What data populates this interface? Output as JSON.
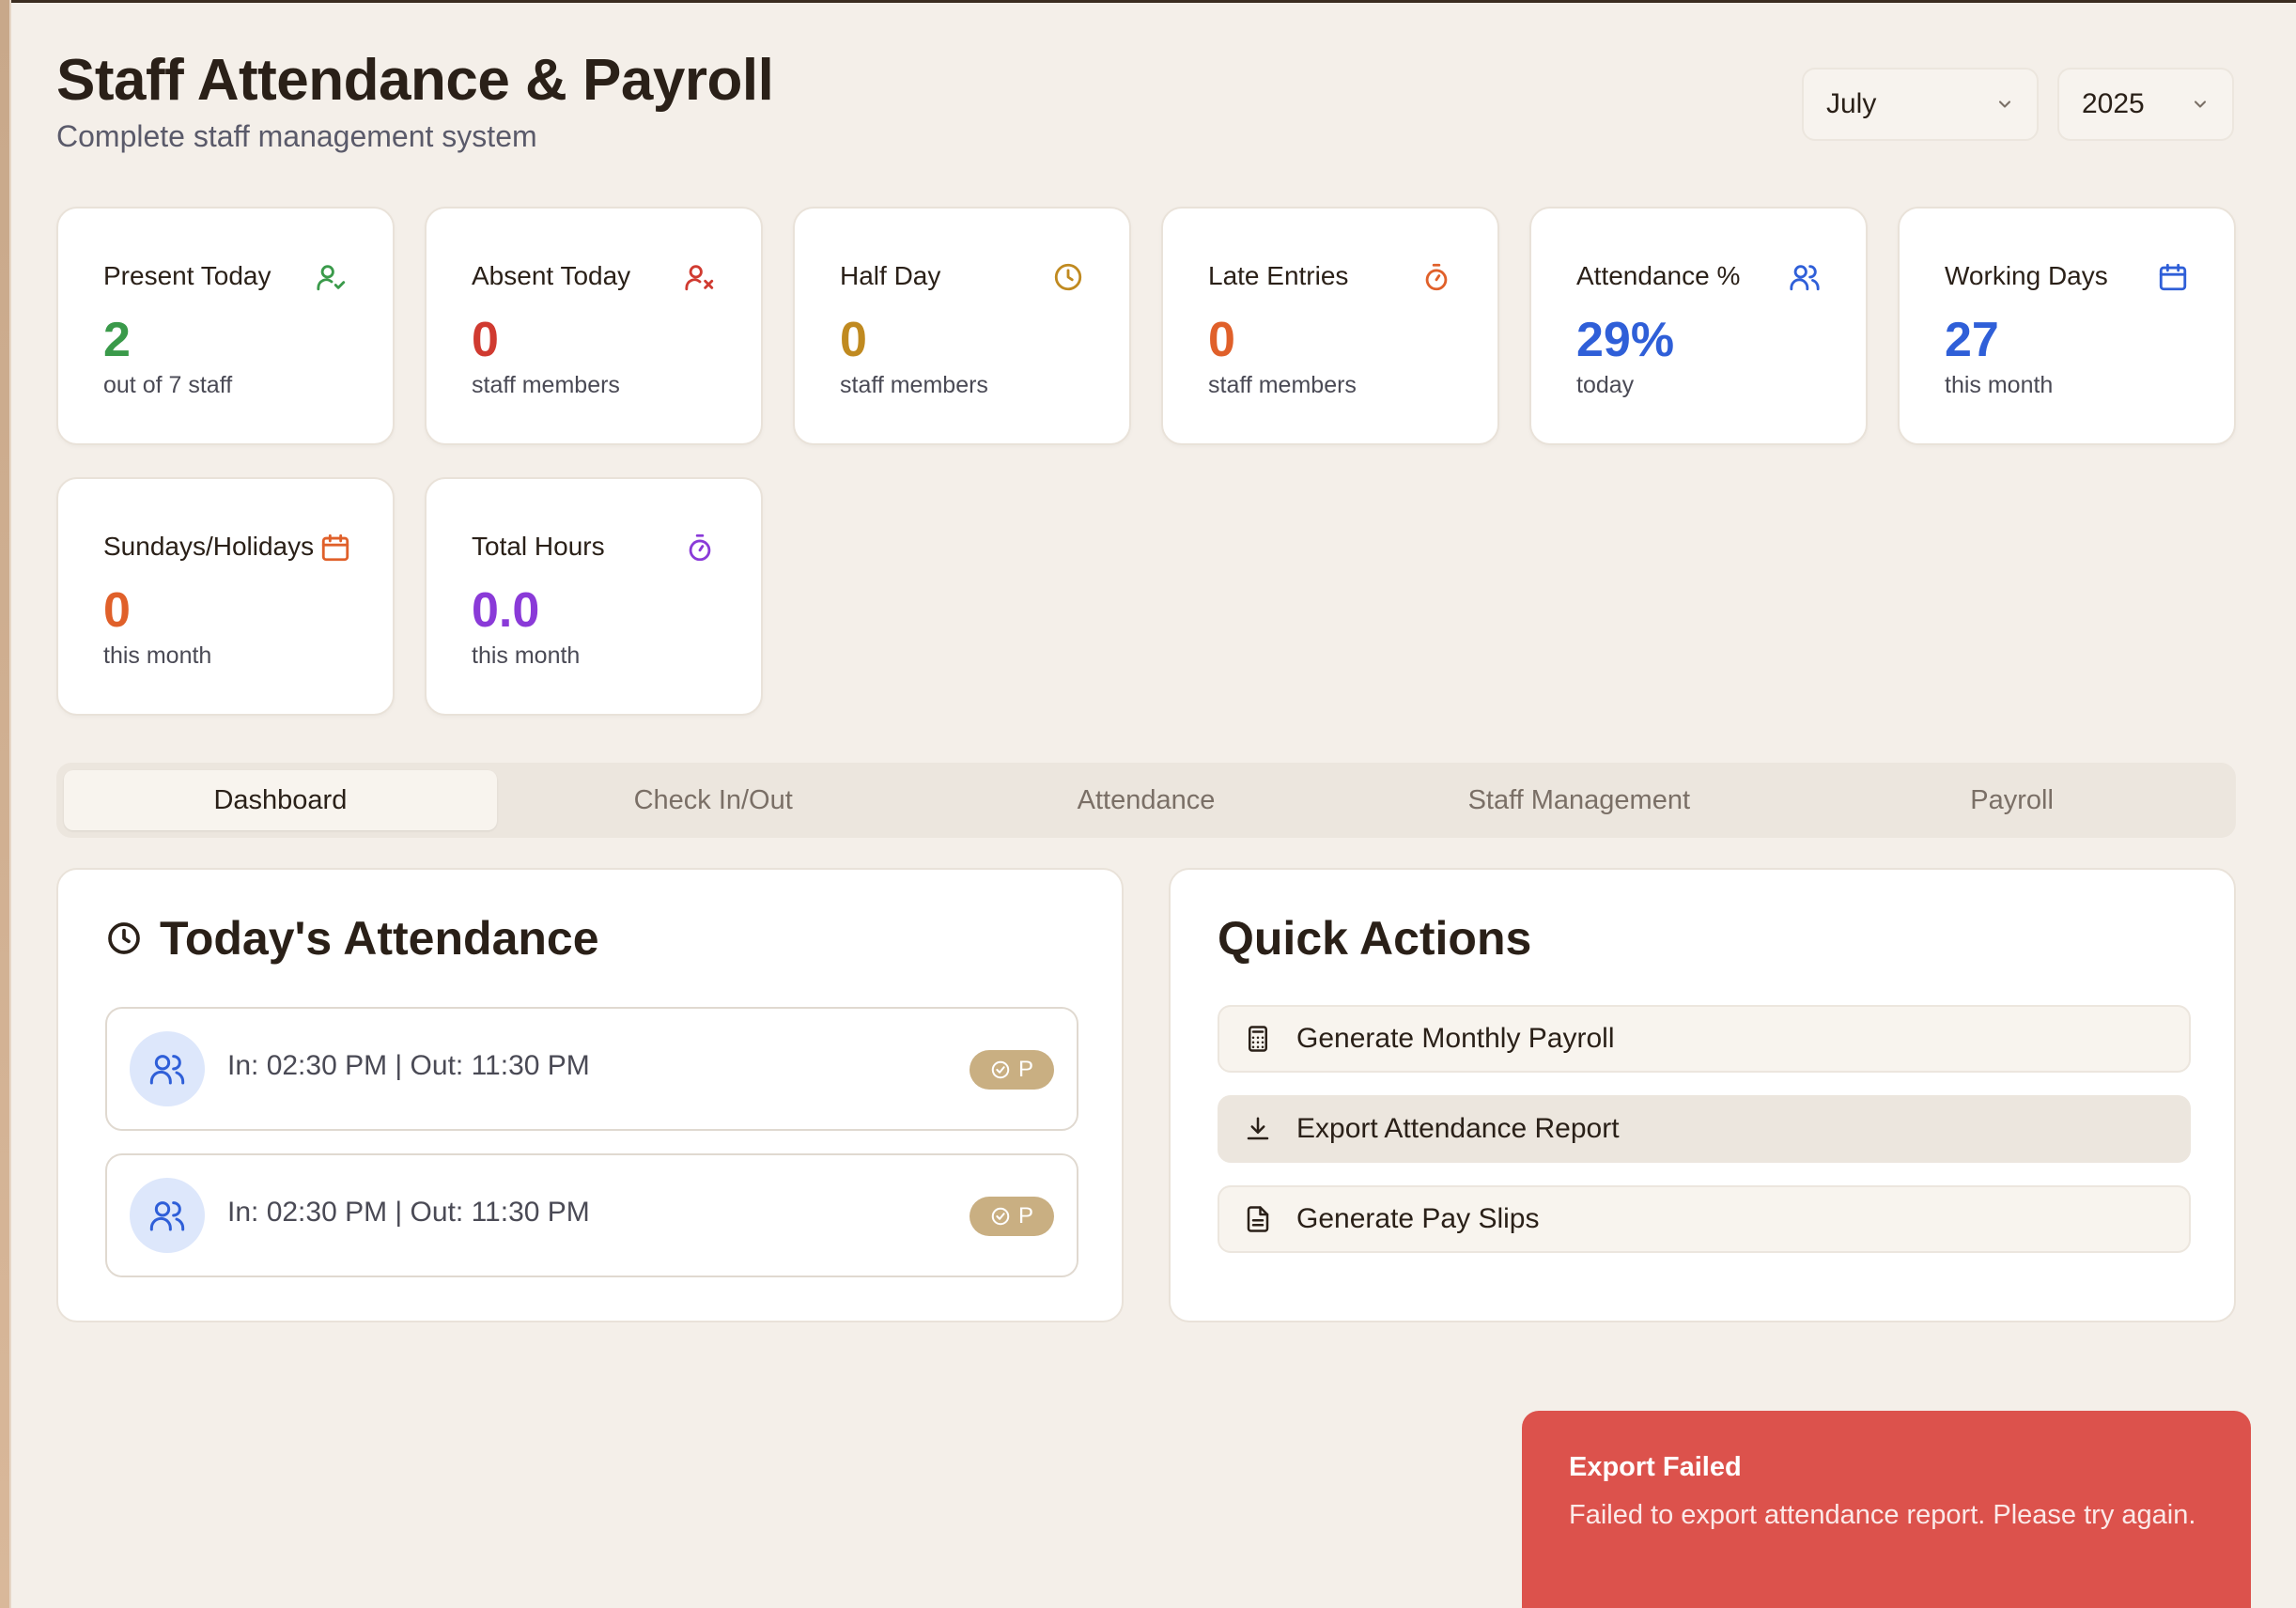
{
  "header": {
    "title": "Staff Attendance & Payroll",
    "subtitle": "Complete staff management system"
  },
  "filters": {
    "month": "July",
    "year": "2025"
  },
  "stats": [
    {
      "label": "Present Today",
      "value": "2",
      "sub": "out of 7 staff",
      "icon": "user-check-icon",
      "color": "#3a9a4a"
    },
    {
      "label": "Absent Today",
      "value": "0",
      "sub": "staff members",
      "icon": "user-x-icon",
      "color": "#d03a30"
    },
    {
      "label": "Half Day",
      "value": "0",
      "sub": "staff members",
      "icon": "clock-icon",
      "color": "#c08a20"
    },
    {
      "label": "Late Entries",
      "value": "0",
      "sub": "staff members",
      "icon": "timer-icon",
      "color": "#e0602a"
    },
    {
      "label": "Attendance %",
      "value": "29%",
      "sub": "today",
      "icon": "users-icon",
      "color": "#2f5fd8"
    },
    {
      "label": "Working Days",
      "value": "27",
      "sub": "this month",
      "icon": "calendar-icon",
      "color": "#2f5fd8"
    },
    {
      "label": "Sundays/Holidays",
      "value": "0",
      "sub": "this month",
      "icon": "calendar-icon",
      "color": "#e0602a"
    },
    {
      "label": "Total Hours",
      "value": "0.0",
      "sub": "this month",
      "icon": "timer-icon",
      "color": "#8a3ad8"
    }
  ],
  "tabs": [
    "Dashboard",
    "Check In/Out",
    "Attendance",
    "Staff Management",
    "Payroll"
  ],
  "active_tab": "Dashboard",
  "todays_attendance": {
    "title": "Today's Attendance",
    "rows": [
      {
        "time": "In: 02:30 PM | Out: 11:30 PM",
        "status": "P"
      },
      {
        "time": "In: 02:30 PM | Out: 11:30 PM",
        "status": "P"
      }
    ]
  },
  "quick_actions": {
    "title": "Quick Actions",
    "buttons": [
      {
        "label": "Generate Monthly Payroll",
        "icon": "calculator-icon"
      },
      {
        "label": "Export Attendance Report",
        "icon": "download-icon"
      },
      {
        "label": "Generate Pay Slips",
        "icon": "file-text-icon"
      }
    ]
  },
  "toast": {
    "title": "Export Failed",
    "message": "Failed to export attendance report. Please try again."
  }
}
